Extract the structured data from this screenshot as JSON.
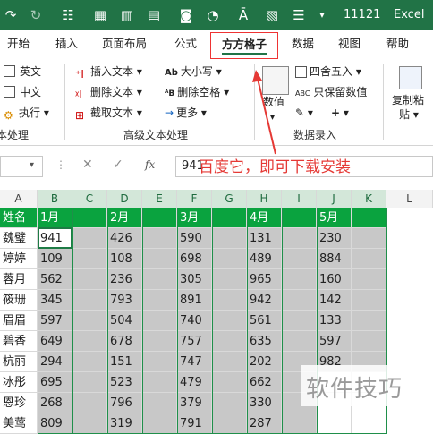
{
  "title_bar": {
    "filename": "11121",
    "app": "Excel"
  },
  "tabs": [
    "开始",
    "插入",
    "页面布局",
    "公式",
    "方方格子",
    "数据",
    "视图",
    "帮助"
  ],
  "ribbon": {
    "group_text": {
      "options": [
        "英文",
        "中文",
        "执行"
      ],
      "label": "本处理"
    },
    "group_advanced": {
      "col1": [
        "插入文本",
        "删除文本",
        "截取文本"
      ],
      "col2": [
        "大小写",
        "删除空格",
        "更多"
      ],
      "label": "高级文本处理"
    },
    "numeric_label": "数值",
    "group_data": {
      "items": [
        "四舍五入",
        "只保留数值"
      ],
      "label": "数据录入"
    },
    "copy_paste": [
      "复制粘",
      "贴"
    ]
  },
  "formula_bar": {
    "fx": "fx",
    "value": "941"
  },
  "annotation": "百度它，即可下载安装",
  "watermark": "软件技巧",
  "sheet": {
    "columns": [
      "A",
      "B",
      "C",
      "D",
      "E",
      "F",
      "G",
      "H",
      "I",
      "J",
      "K",
      "L"
    ],
    "header_row": [
      "姓名",
      "1月",
      "",
      "2月",
      "",
      "3月",
      "",
      "4月",
      "",
      "5月",
      ""
    ],
    "names": [
      "魏璧",
      "婷婷",
      "蓉月",
      "筱珊",
      "眉眉",
      "碧香",
      "杭丽",
      "冰彤",
      "恩珍",
      "美莺"
    ],
    "rows": [
      [
        "941",
        "426",
        "590",
        "131",
        "230"
      ],
      [
        "109",
        "108",
        "698",
        "489",
        "884"
      ],
      [
        "562",
        "236",
        "305",
        "965",
        "160"
      ],
      [
        "345",
        "793",
        "891",
        "942",
        "142"
      ],
      [
        "597",
        "504",
        "740",
        "561",
        "133"
      ],
      [
        "649",
        "678",
        "757",
        "635",
        "597"
      ],
      [
        "294",
        "151",
        "747",
        "202",
        "982"
      ],
      [
        "695",
        "523",
        "479",
        "662",
        ""
      ],
      [
        "268",
        "796",
        "379",
        "330",
        ""
      ],
      [
        "809",
        "319",
        "791",
        "287",
        ""
      ]
    ]
  }
}
